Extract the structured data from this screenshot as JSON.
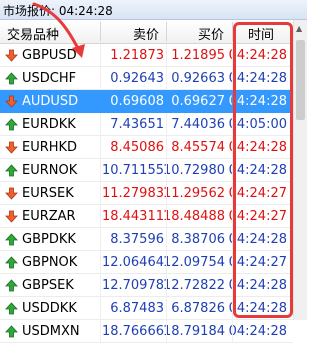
{
  "window": {
    "title": "市场报价: 04:24:28"
  },
  "columns": {
    "symbol": "交易品种",
    "bid": "卖价",
    "ask": "买价",
    "time": "时间"
  },
  "colors": {
    "up": "#1f3fb5",
    "down": "#e01010",
    "selected_row": "#3399ff",
    "highlight_box": "#e83a3a"
  },
  "rows": [
    {
      "symbol": "GBPUSD",
      "bid": "1.21873",
      "ask": "1.21895",
      "time": "04:24:28",
      "direction": "down",
      "selected": false
    },
    {
      "symbol": "USDCHF",
      "bid": "0.92643",
      "ask": "0.92663",
      "time": "04:24:28",
      "direction": "up",
      "selected": false
    },
    {
      "symbol": "AUDUSD",
      "bid": "0.69608",
      "ask": "0.69627",
      "time": "04:24:28",
      "direction": "down",
      "selected": true
    },
    {
      "symbol": "EURDKK",
      "bid": "7.43651",
      "ask": "7.44036",
      "time": "04:05:00",
      "direction": "up",
      "selected": false
    },
    {
      "symbol": "EURHKD",
      "bid": "8.45086",
      "ask": "8.45574",
      "time": "04:24:28",
      "direction": "down",
      "selected": false
    },
    {
      "symbol": "EURNOK",
      "bid": "10.71155",
      "ask": "10.72980",
      "time": "04:24:28",
      "direction": "up",
      "selected": false
    },
    {
      "symbol": "EURSEK",
      "bid": "11.27983",
      "ask": "11.29562",
      "time": "04:24:27",
      "direction": "down",
      "selected": false
    },
    {
      "symbol": "EURZAR",
      "bid": "18.44311",
      "ask": "18.48488",
      "time": "04:24:27",
      "direction": "down",
      "selected": false
    },
    {
      "symbol": "GBPDKK",
      "bid": "8.37596",
      "ask": "8.38706",
      "time": "04:24:28",
      "direction": "up",
      "selected": false
    },
    {
      "symbol": "GBPNOK",
      "bid": "12.06464",
      "ask": "12.09754",
      "time": "04:24:27",
      "direction": "up",
      "selected": false
    },
    {
      "symbol": "GBPSEK",
      "bid": "12.70978",
      "ask": "12.72822",
      "time": "04:24:28",
      "direction": "up",
      "selected": false
    },
    {
      "symbol": "USDDKK",
      "bid": "6.87483",
      "ask": "6.87826",
      "time": "04:24:28",
      "direction": "up",
      "selected": false
    },
    {
      "symbol": "USDMXN",
      "bid": "18.76666",
      "ask": "18.79184",
      "time": "04:24:28",
      "direction": "up",
      "selected": false
    }
  ]
}
